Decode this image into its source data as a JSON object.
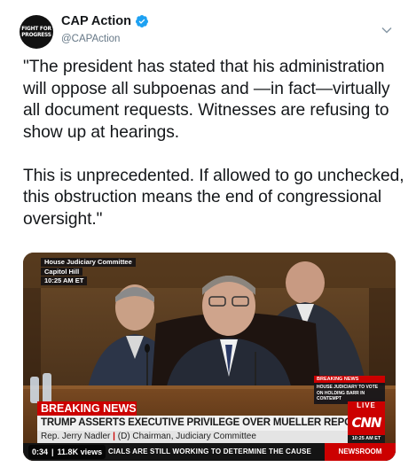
{
  "account": {
    "display_name": "CAP Action",
    "handle": "@CAPAction",
    "avatar_text": [
      "FIGHT FOR",
      "PROGRESS"
    ],
    "verified": true
  },
  "tweet": {
    "text": "\"The president has stated that his administration will oppose all subpoenas and —in fact—virtually all document requests. Witnesses are refusing to show up at hearings.\n\nThis is unprecedented. If allowed to go unchecked, this obstruction means the end of congressional oversight.\""
  },
  "video": {
    "location_lines": [
      "House Judiciary Committee",
      "Capitol Hill",
      "10:25 AM ET"
    ],
    "breaking_small": {
      "title": "BREAKING NEWS",
      "text": "HOUSE JUDICIARY TO VOTE ON HOLDING BARR IN CONTEMPT"
    },
    "breaking_label": "BREAKING NEWS",
    "headline": "TRUMP ASSERTS EXECUTIVE PRIVILEGE OVER MUELLER REPORT",
    "speaker_name": "Rep. Jerry Nadler",
    "speaker_title": "(D) Chairman, Judiciary Committee",
    "ticker": "CIALS ARE STILL WORKING TO DETERMINE THE CAUSE",
    "show_name": "NEWSROOM",
    "live_label": "LIVE",
    "network_logo": "CNN",
    "clock": "10:25 AM ET",
    "elapsed": "0:34",
    "views": "11.8K views"
  },
  "colors": {
    "verified_blue": "#1da1f2",
    "cnn_red": "#cc0000",
    "text_primary": "#14171a",
    "text_secondary": "#657786"
  },
  "icons": {
    "verified": "verified-badge-icon",
    "menu": "chevron-down-icon"
  }
}
